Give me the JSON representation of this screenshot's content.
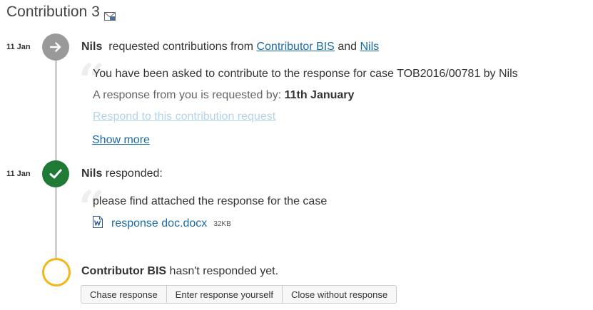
{
  "page": {
    "title": "Contribution 3"
  },
  "timeline": {
    "entry1": {
      "date": "11 Jan",
      "author": "Nils",
      "action": "requested contributions from",
      "recipient1": "Contributor BIS",
      "conjunction": "and",
      "recipient2": "Nils",
      "message": "You have been asked to contribute to the response for case TOB2016/00781 by Nils",
      "deadline_label": "A response from you is requested by:",
      "deadline_value": "11th January",
      "respond_link": "Respond to this contribution request",
      "show_more": "Show more"
    },
    "entry2": {
      "date": "11 Jan",
      "author": "Nils",
      "action": "responded:",
      "message": "please find attached the response for the case",
      "attachment_name": "response doc.docx",
      "attachment_size": "32KB"
    },
    "entry3": {
      "author": "Contributor BIS",
      "status": "hasn't responded yet.",
      "actions": {
        "chase": "Chase response",
        "enter": "Enter response yourself",
        "close": "Close without response"
      }
    }
  },
  "colors": {
    "link": "#1a6aa6",
    "success": "#1e7a34",
    "pending": "#f2b619",
    "neutral": "#999999"
  },
  "icons": [
    "envelope-icon",
    "arrow-right-icon",
    "checkmark-icon",
    "word-document-icon"
  ]
}
